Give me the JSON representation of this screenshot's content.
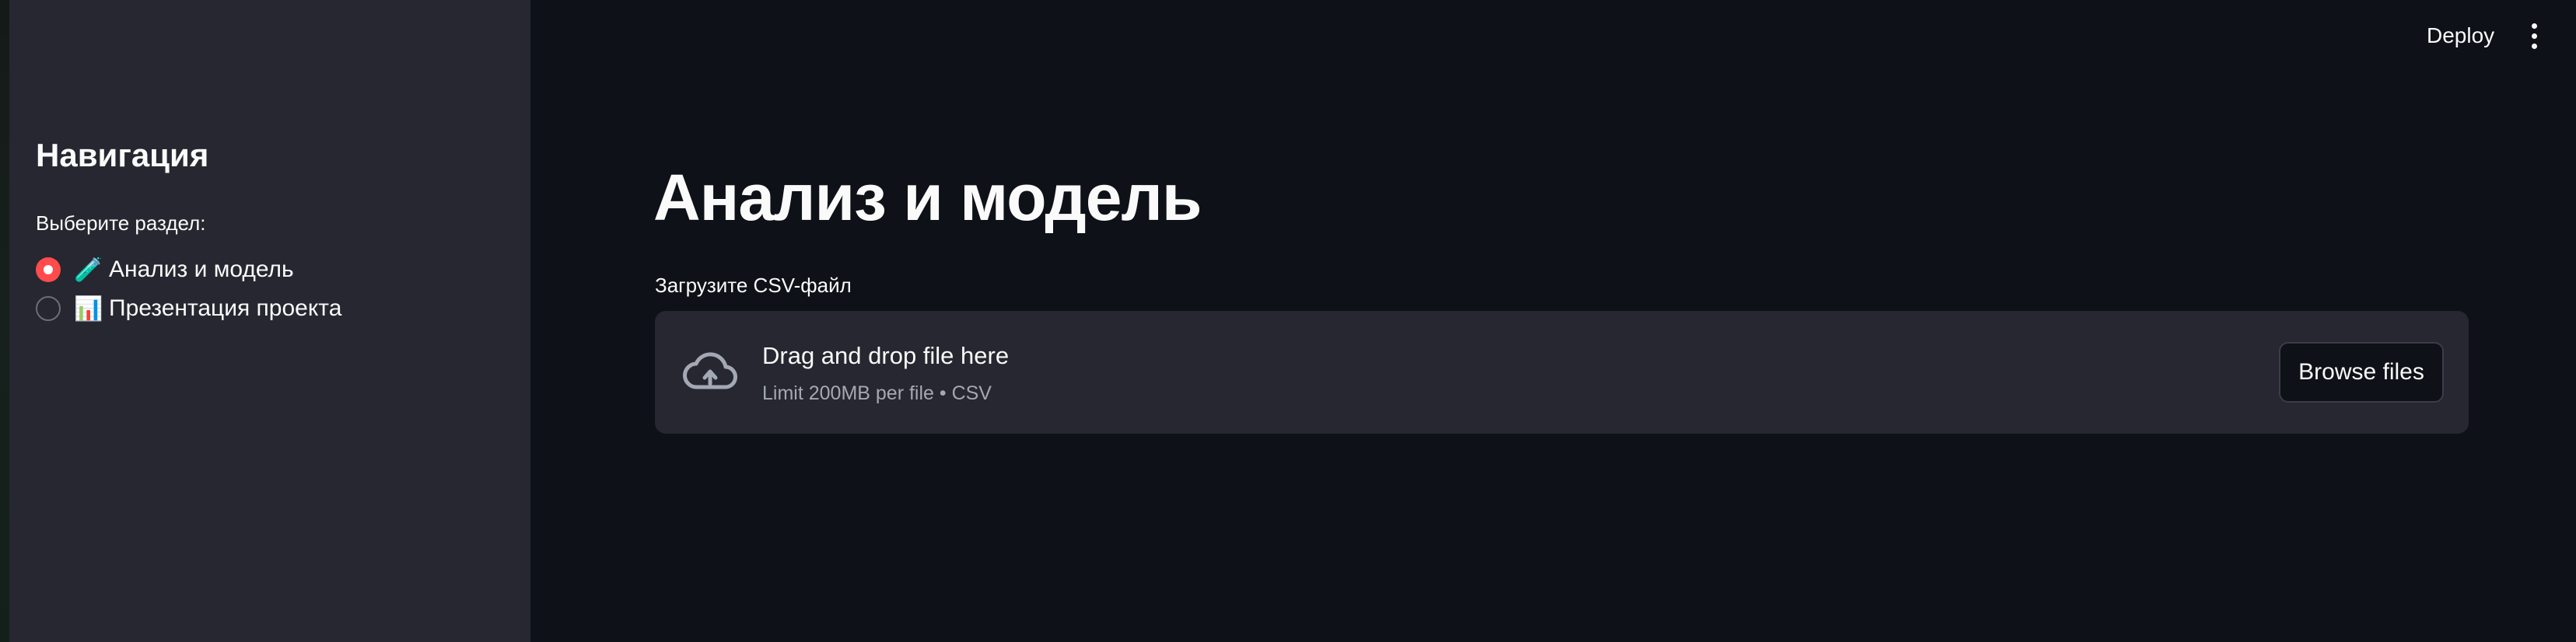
{
  "sidebar": {
    "title": "Навигация",
    "radio_caption": "Выберите раздел:",
    "options": [
      {
        "emoji": "🧪",
        "label": "Анализ и модель",
        "selected": true
      },
      {
        "emoji": "📊",
        "label": "Презентация проекта",
        "selected": false
      }
    ]
  },
  "topbar": {
    "deploy_label": "Deploy",
    "menu_icon": "vertical-ellipsis-icon"
  },
  "main": {
    "title": "Анализ и модель",
    "uploader": {
      "label": "Загрузите CSV-файл",
      "icon": "cloud-upload-icon",
      "drop_text": "Drag and drop file here",
      "limit_text": "Limit 200MB per file • CSV",
      "browse_label": "Browse files"
    }
  },
  "colors": {
    "background": "#0e1117",
    "sidebar": "#262730",
    "accent": "#ff4b4b",
    "muted_text": "#a3a8b4"
  }
}
